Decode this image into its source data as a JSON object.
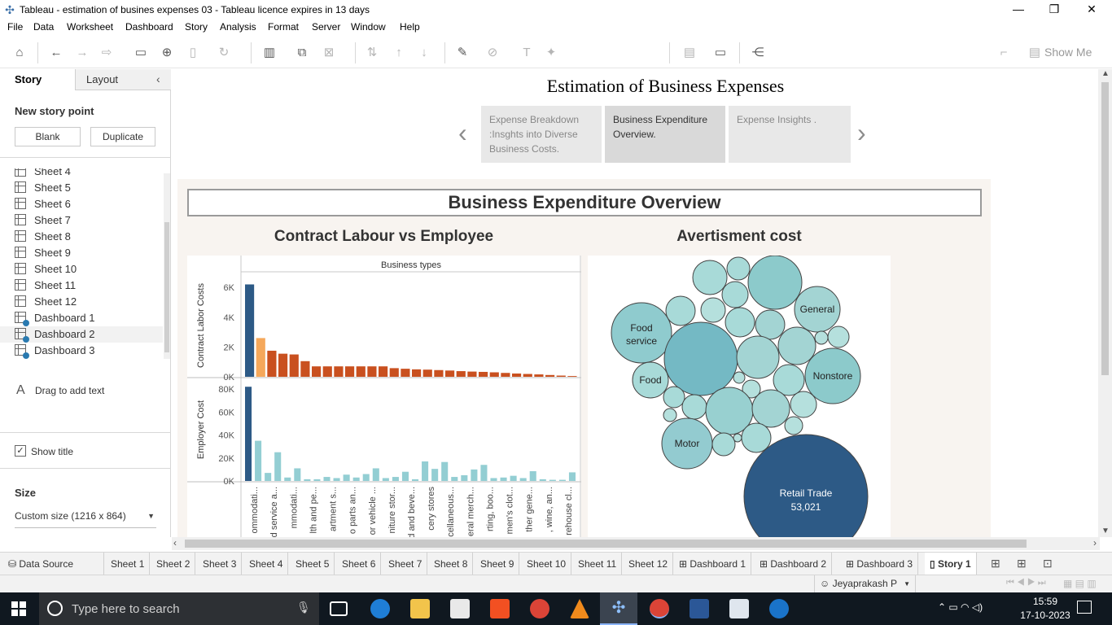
{
  "window": {
    "title": "Tableau - estimation of busines expenses 03 - Tableau licence expires in 13 days",
    "minimize_glyph": "—",
    "restore_glyph": "❐",
    "close_glyph": "✕"
  },
  "menu": [
    "File",
    "Data",
    "Worksheet",
    "Dashboard",
    "Story",
    "Analysis",
    "Format",
    "Server",
    "Window",
    "Help"
  ],
  "toolbar": {
    "show_me_label": "Show Me"
  },
  "left_pane": {
    "tab_story": "Story",
    "tab_layout": "Layout",
    "new_story_point": "New story point",
    "blank_button": "Blank",
    "duplicate_button": "Duplicate",
    "sheets_partial": "Sheet 4",
    "sheets": [
      "Sheet 5",
      "Sheet 6",
      "Sheet 7",
      "Sheet 8",
      "Sheet 9",
      "Sheet 10",
      "Sheet 11",
      "Sheet 12"
    ],
    "dashboards": [
      "Dashboard 1",
      "Dashboard 2",
      "Dashboard 3"
    ],
    "drag_text_icon": "A",
    "drag_text": "Drag to add text",
    "show_title_label": "Show title",
    "show_title_checked": true,
    "size_heading": "Size",
    "size_value": "Custom size (1216 x 864)"
  },
  "story": {
    "title": "Estimation of Business Expenses",
    "points": [
      {
        "label": "Expense Breakdown :Insghts into Diverse Business Costs.",
        "active": false
      },
      {
        "label": "Business Expenditure Overview.",
        "active": true
      },
      {
        "label": "Expense Insights .",
        "active": false
      }
    ],
    "dashboard_title": "Business Expenditure Overview"
  },
  "chart_data": [
    {
      "type": "bar",
      "title": "Contract Labour vs Employee",
      "column_header": "Business types",
      "panels": [
        {
          "ylabel": "Contract Labor Costs",
          "yticks": [
            "6K",
            "4K",
            "2K",
            "0K"
          ],
          "ylim": [
            0,
            6500
          ],
          "values": [
            6200,
            2600,
            1750,
            1550,
            1500,
            1050,
            700,
            700,
            700,
            700,
            700,
            700,
            700,
            580,
            540,
            500,
            480,
            450,
            420,
            380,
            350,
            330,
            300,
            260,
            220,
            190,
            160,
            120,
            80,
            50
          ]
        },
        {
          "ylabel": "Employer Cost",
          "yticks": [
            "80K",
            "60K",
            "40K",
            "20K",
            "0K"
          ],
          "ylim": [
            0,
            85000
          ],
          "values": [
            82000,
            35000,
            7000,
            25000,
            3000,
            11000,
            1500,
            1500,
            3500,
            2500,
            5500,
            3000,
            6000,
            11000,
            2500,
            3500,
            8000,
            1500,
            17000,
            10500,
            16500,
            3500,
            5000,
            10000,
            14000,
            2500,
            3000,
            4500,
            2500,
            8500,
            1500,
            1000,
            1000,
            7500
          ]
        }
      ],
      "colors": {
        "first": "#2d5a86",
        "contract_second": "#f5a85b",
        "contract_rest": "#c9501f",
        "employer_rest": "#93ced3"
      },
      "categories": [
        "ommodati...",
        "d service a...",
        "mmodati...",
        "lth and pe...",
        "artment s...",
        "o parts an...",
        "or vehicle ...",
        "niture stor...",
        "d and beve...",
        "cery stores",
        "cellaneous...",
        "eral merch...",
        "rting, boo...",
        "men's clot...",
        "ther gene...",
        ", wine, an...",
        "rehouse cl..."
      ]
    },
    {
      "type": "bubble",
      "title": "Avertisment cost",
      "labeled": [
        {
          "label": "Retail Trade",
          "value": "53,021"
        },
        {
          "label": "General"
        },
        {
          "label": "Food service"
        },
        {
          "label": "Nonstore"
        },
        {
          "label": "Food"
        },
        {
          "label": "Motor"
        }
      ]
    }
  ],
  "sheet_tabs": [
    "Data Source",
    "Sheet 1",
    "Sheet 2",
    "Sheet 3",
    "Sheet 4",
    "Sheet 5",
    "Sheet 6",
    "Sheet 7",
    "Sheet 8",
    "Sheet 9",
    "Sheet 10",
    "Sheet 11",
    "Sheet 12",
    "Dashboard 1",
    "Dashboard 2",
    "Dashboard 3",
    "Story 1"
  ],
  "status": {
    "user": "Jeyaprakash P"
  },
  "taskbar": {
    "search_placeholder": "Type here to search",
    "time": "15:59",
    "date": "17-10-2023"
  }
}
